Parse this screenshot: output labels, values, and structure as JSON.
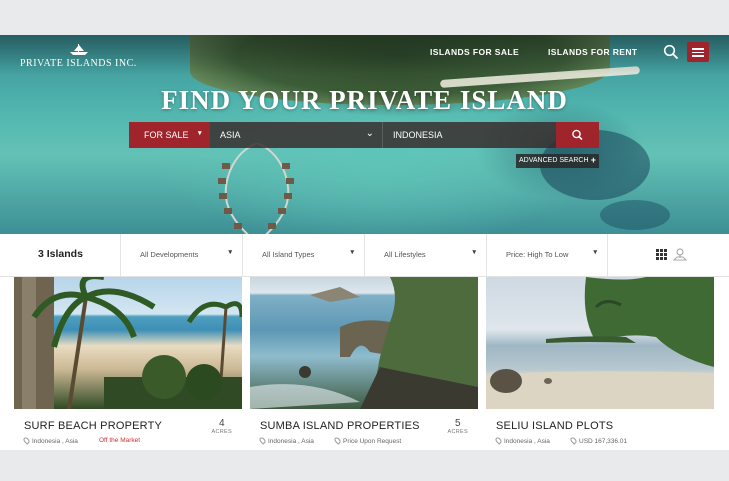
{
  "header": {
    "logo_text": "PRIVATE ISLANDS INC.",
    "nav": [
      "ISLANDS FOR SALE",
      "ISLANDS FOR RENT"
    ]
  },
  "hero": {
    "title": "FIND YOUR PRIVATE ISLAND",
    "search": {
      "mode": "FOR SALE",
      "region": "ASIA",
      "country": "INDONESIA"
    },
    "advanced_search": "ADVANCED SEARCH"
  },
  "filters": {
    "count": "3 Islands",
    "developments": "All Developments",
    "island_types": "All Island Types",
    "lifestyles": "All Lifestyles",
    "sort": "Price: High To Low"
  },
  "listings": [
    {
      "title": "SURF BEACH PROPERTY",
      "location": "Indonesia , Asia",
      "status": "Off the Market",
      "acres": "4",
      "acres_label": "ACRES"
    },
    {
      "title": "SUMBA ISLAND PROPERTIES",
      "location": "Indonesia , Asia",
      "status": "Price Upon Request",
      "acres": "5",
      "acres_label": "ACRES"
    },
    {
      "title": "SELIU ISLAND PLOTS",
      "location": "Indonesia , Asia",
      "status": "USD 167,336.01"
    }
  ],
  "colors": {
    "brand_red": "#a0242b",
    "status_red": "#cc3333"
  },
  "icons": [
    "ship-logo-icon",
    "search-icon",
    "menu-icon",
    "chevron-down-icon",
    "plus-icon",
    "grid-view-icon",
    "map-view-icon",
    "location-pin-icon"
  ]
}
